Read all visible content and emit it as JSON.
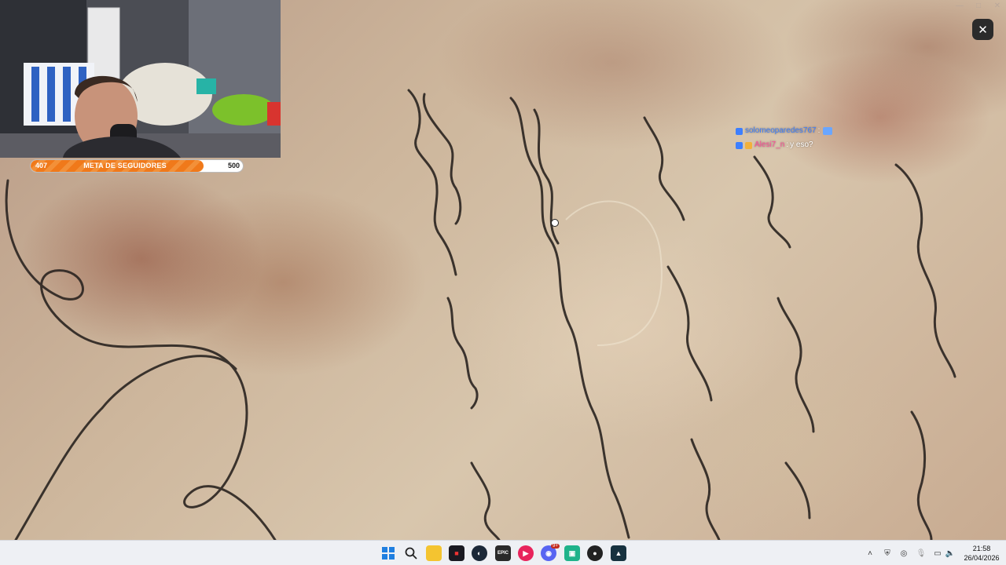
{
  "window": {
    "title": "",
    "close_glyph": "✕"
  },
  "background": {
    "description_color": "#c9b39b"
  },
  "follower_goal": {
    "current": "407",
    "title": "META DE SEGUIDORES",
    "goal": "500",
    "progress_fraction": 0.814,
    "fill_color": "#f0791a"
  },
  "chat": {
    "messages": [
      {
        "user": "solomeoparedes767",
        "separator": ":",
        "text": "",
        "user_color": "#3d7fff"
      },
      {
        "user": "Alesi7_n",
        "separator": ":",
        "text": "y eso?",
        "user_color": "#ff4f9a"
      }
    ]
  },
  "taskbar": {
    "icons": [
      "windows-start-icon",
      "search-icon",
      "file-explorer-icon",
      "app-icon",
      "steam-icon",
      "epic-games-icon",
      "media-player-icon",
      "discord-icon",
      "app-icon-2",
      "obs-icon",
      "app-icon-3"
    ],
    "discord_badge": "9+",
    "clock": {
      "time": "21:58",
      "date": "26/04/2026"
    }
  }
}
